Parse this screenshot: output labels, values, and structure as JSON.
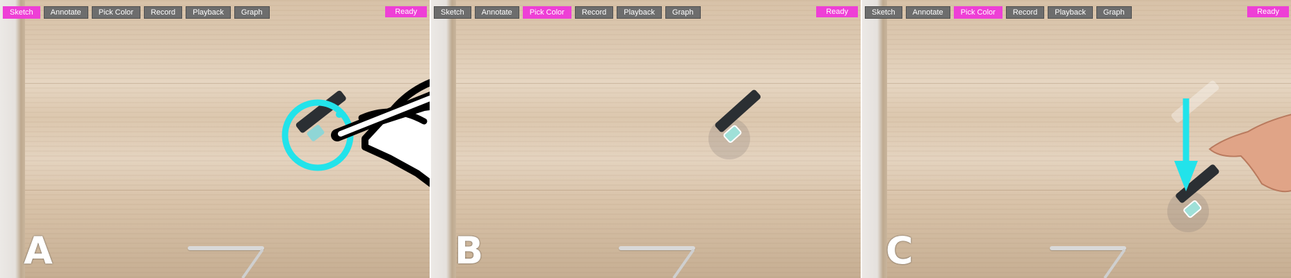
{
  "panels": [
    {
      "label": "A",
      "toolbar": [
        "Sketch",
        "Annotate",
        "Pick Color",
        "Record",
        "Playback",
        "Graph"
      ],
      "active": "Sketch",
      "status": "Ready"
    },
    {
      "label": "B",
      "toolbar": [
        "Sketch",
        "Annotate",
        "Pick Color",
        "Record",
        "Playback",
        "Graph"
      ],
      "active": "Pick Color",
      "status": "Ready"
    },
    {
      "label": "C",
      "toolbar": [
        "Sketch",
        "Annotate",
        "Pick Color",
        "Record",
        "Playback",
        "Graph"
      ],
      "active": "Pick Color",
      "status": "Ready"
    }
  ],
  "colors": {
    "accent": "#ee3fd6",
    "toolbar_button": "#6d6d6d",
    "annotation": "#22e3ea"
  },
  "icons": {
    "panel_a": [
      "hand-with-stylus-icon",
      "selection-circle-icon",
      "pen-icon"
    ],
    "panel_b": [
      "pen-icon",
      "shadow-highlight-icon"
    ],
    "panel_c": [
      "motion-arrow-icon",
      "hand-icon",
      "pen-icon"
    ]
  }
}
